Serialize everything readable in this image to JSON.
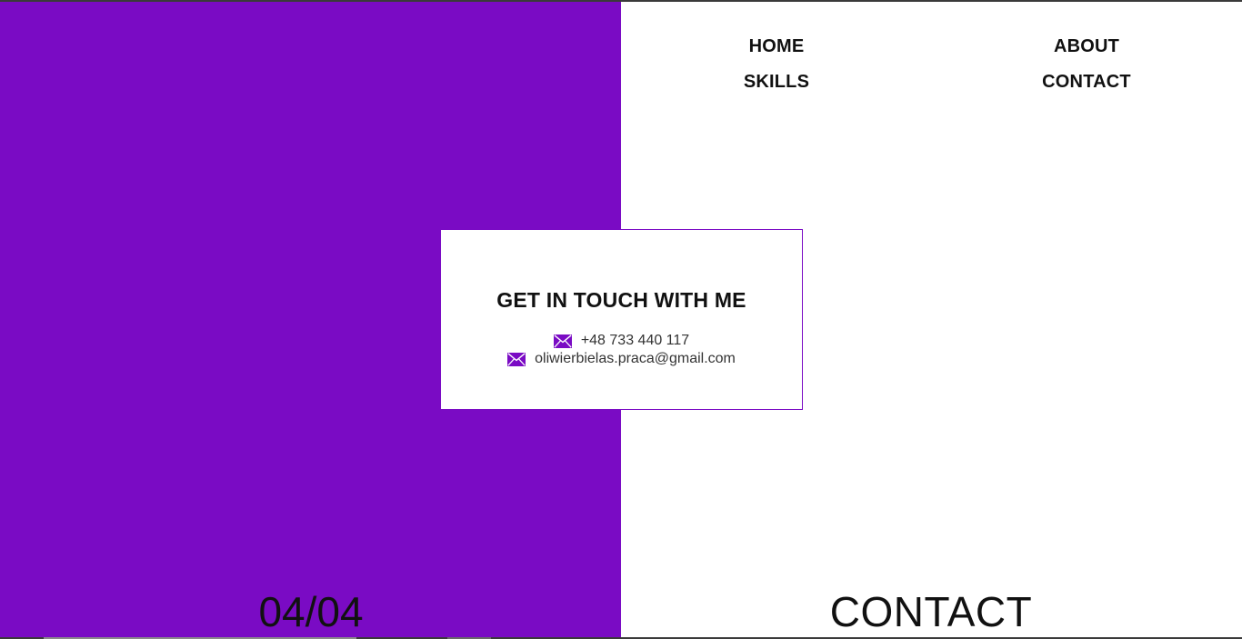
{
  "nav": {
    "home": "HOME",
    "about": "ABOUT",
    "skills": "SKILLS",
    "contact": "CONTACT"
  },
  "card": {
    "title": "GET IN TOUCH WITH ME",
    "phone": "+48 733 440 117",
    "email": "oliwierbielas.praca@gmail.com",
    "phone_icon": "mail-icon",
    "email_icon": "mail-icon"
  },
  "footer": {
    "counter": "04/04",
    "section": "CONTACT"
  },
  "colors": {
    "accent": "#7a0bc4",
    "text": "#111111",
    "background": "#ffffff"
  }
}
